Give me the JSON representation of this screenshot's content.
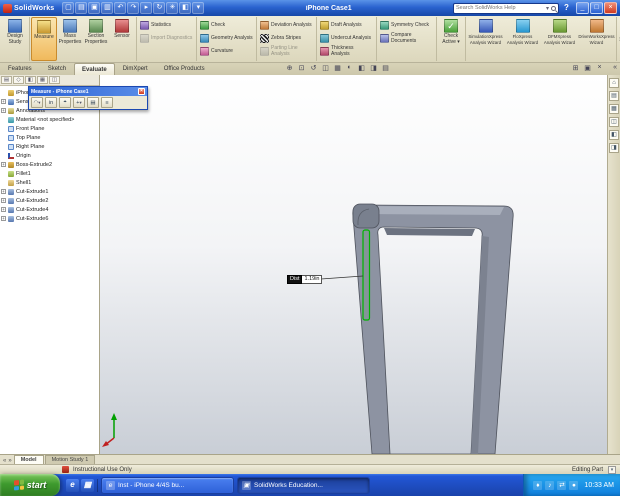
{
  "titlebar": {
    "app_name": "SolidWorks",
    "document_title": "iPhone Case1",
    "icons": [
      {
        "name": "new-icon",
        "glyph": "▢"
      },
      {
        "name": "open-icon",
        "glyph": "▤"
      },
      {
        "name": "save-icon",
        "glyph": "▣"
      },
      {
        "name": "print-icon",
        "glyph": "▥"
      },
      {
        "name": "undo-icon",
        "glyph": "↶"
      },
      {
        "name": "redo-icon",
        "glyph": "↷"
      },
      {
        "name": "select-icon",
        "glyph": "▸"
      },
      {
        "name": "rebuild-icon",
        "glyph": "↻"
      },
      {
        "name": "options-icon",
        "glyph": "✳"
      },
      {
        "name": "appearance-icon",
        "glyph": "◧"
      },
      {
        "name": "toolbar-more-icon",
        "glyph": "▾"
      }
    ],
    "search": {
      "placeholder": "Search SolidWorks Help",
      "arrow": "▾"
    },
    "help_glyph": "?",
    "window_buttons": [
      {
        "name": "minimize-button",
        "glyph": "_"
      },
      {
        "name": "maximize-button",
        "glyph": "□"
      },
      {
        "name": "close-button",
        "glyph": "×"
      }
    ]
  },
  "ribbon": {
    "overflow_glyph": "»",
    "groups": [
      {
        "type": "big",
        "items": [
          {
            "label": "Design Study",
            "icon": "design-study"
          }
        ]
      },
      {
        "type": "big",
        "items": [
          {
            "label": "Measure",
            "icon": "measure",
            "state": "active"
          },
          {
            "label": "Mass Properties",
            "icon": "mass-properties"
          },
          {
            "label": "Section Properties",
            "icon": "section-properties"
          },
          {
            "label": "Sensor",
            "icon": "sensor"
          }
        ]
      },
      {
        "type": "col",
        "items": [
          {
            "label": "Statistics",
            "icon": "statistics"
          },
          {
            "label": "Import Diagnostics",
            "icon": "import-diagnostics",
            "state": "disabled"
          }
        ]
      },
      {
        "type": "col",
        "items": [
          {
            "label": "Check",
            "icon": "check"
          },
          {
            "label": "Geometry Analysis",
            "icon": "geometry-analysis"
          },
          {
            "label": "Curvature",
            "icon": "curvature"
          }
        ]
      },
      {
        "type": "col",
        "items": [
          {
            "label": "Deviation Analysis",
            "icon": "deviation"
          },
          {
            "label": "Zebra Stripes",
            "icon": "zebra"
          },
          {
            "label": "Parting Line Analysis",
            "icon": "parting-line",
            "state": "disabled"
          }
        ]
      },
      {
        "type": "col",
        "items": [
          {
            "label": "Draft Analysis",
            "icon": "draft"
          },
          {
            "label": "Undercut Analysis",
            "icon": "undercut"
          },
          {
            "label": "Thickness Analysis",
            "icon": "thickness"
          }
        ]
      },
      {
        "type": "col",
        "items": [
          {
            "label": "Symmetry Check",
            "icon": "symmetry"
          },
          {
            "label": "Compare Documents",
            "icon": "compare"
          }
        ]
      },
      {
        "type": "big",
        "items": [
          {
            "label": "Check Active ▾",
            "icon": "check-active",
            "icon_glyph": "✓"
          }
        ]
      },
      {
        "type": "big",
        "size": "wide",
        "items": [
          {
            "label": "SimulationXpress Analysis Wizard",
            "icon": "simulationxpress"
          },
          {
            "label": "FloXpress Analysis Wizard",
            "icon": "floxpress"
          },
          {
            "label": "DFMXpress Analysis Wizard",
            "icon": "dfmxpress"
          },
          {
            "label": "DriveWorksXpress Wizard",
            "icon": "driveworksxpress"
          }
        ]
      }
    ]
  },
  "command_tabs": {
    "tabs": [
      {
        "label": "Features"
      },
      {
        "label": "Sketch"
      },
      {
        "label": "Evaluate",
        "state": "active"
      },
      {
        "label": "DimXpert"
      },
      {
        "label": "Office Products"
      }
    ],
    "collapse_glyph": "«"
  },
  "headsup": {
    "icons": [
      {
        "name": "zoom-fit-icon",
        "glyph": "⊕"
      },
      {
        "name": "zoom-area-icon",
        "glyph": "⊡"
      },
      {
        "name": "previous-view-icon",
        "glyph": "↺"
      },
      {
        "name": "section-view-icon",
        "glyph": "◫"
      },
      {
        "name": "view-orientation-icon",
        "glyph": "▦"
      },
      {
        "name": "display-style-icon",
        "glyph": "◐"
      },
      {
        "name": "hide-show-icon",
        "glyph": "◧"
      },
      {
        "name": "appearance-icon",
        "glyph": "◨"
      },
      {
        "name": "scene-icon",
        "glyph": "▤"
      }
    ],
    "right_icons": [
      {
        "name": "fullscreen-icon",
        "glyph": "⊞"
      },
      {
        "name": "panel-layout-icon",
        "glyph": "▣"
      },
      {
        "name": "close-toolbar-icon",
        "glyph": "×"
      }
    ]
  },
  "feature_tree": {
    "panel_tabs": [
      {
        "name": "feature-manager-tab",
        "glyph": "▤"
      },
      {
        "name": "property-manager-tab",
        "glyph": "◇"
      },
      {
        "name": "configuration-manager-tab",
        "glyph": "◧"
      },
      {
        "name": "dimxpert-manager-tab",
        "glyph": "▦"
      },
      {
        "name": "display-manager-tab",
        "glyph": "◫"
      }
    ],
    "root": {
      "label": "iPhone Case1",
      "icon": "part"
    },
    "items": [
      {
        "label": "Sensors",
        "icon": "sensors",
        "expand": "+"
      },
      {
        "label": "Annotations",
        "icon": "annotations",
        "expand": "+"
      },
      {
        "label": "Material <not specified>",
        "icon": "material"
      },
      {
        "label": "Front Plane",
        "icon": "plane"
      },
      {
        "label": "Top Plane",
        "icon": "plane"
      },
      {
        "label": "Right Plane",
        "icon": "plane"
      },
      {
        "label": "Origin",
        "icon": "origin"
      },
      {
        "label": "Boss-Extrude2",
        "icon": "boss",
        "expand": "+"
      },
      {
        "label": "Fillet1",
        "icon": "fillet"
      },
      {
        "label": "Shell1",
        "icon": "shell"
      },
      {
        "label": "Cut-Extrude1",
        "icon": "cut",
        "expand": "+"
      },
      {
        "label": "Cut-Extrude2",
        "icon": "cut",
        "expand": "+"
      },
      {
        "label": "Cut-Extrude4",
        "icon": "cut",
        "expand": "+"
      },
      {
        "label": "Cut-Extrude6",
        "icon": "cut",
        "expand": "+"
      }
    ]
  },
  "measure_dialog": {
    "title": "Measure - iPhone Case1",
    "close_glyph": "×",
    "buttons": [
      {
        "name": "arc-circle-measure-button",
        "glyph": "◠",
        "dropdown": "▾"
      },
      {
        "name": "units-button",
        "glyph": "in"
      },
      {
        "name": "show-xyz-button",
        "glyph": "⌖"
      },
      {
        "name": "point-to-point-button",
        "glyph": "+",
        "dropdown": "▾"
      },
      {
        "name": "measurement-history-button",
        "glyph": "▤"
      },
      {
        "name": "dialog-expand-button",
        "glyph": "≡"
      }
    ]
  },
  "viewport": {
    "measurement": {
      "label": "Dist",
      "value": "1.19in"
    }
  },
  "taskpane": {
    "icons": [
      {
        "name": "solidworks-resources-icon",
        "glyph": "⌂"
      },
      {
        "name": "design-library-icon",
        "glyph": "▤"
      },
      {
        "name": "file-explorer-icon",
        "glyph": "▦"
      },
      {
        "name": "search-pane-icon",
        "glyph": "◫"
      },
      {
        "name": "view-palette-icon",
        "glyph": "◧"
      },
      {
        "name": "custom-properties-icon",
        "glyph": "◨"
      }
    ]
  },
  "bottom_tabs": {
    "nav": [
      {
        "name": "tab-scroll-left-icon",
        "glyph": "«"
      },
      {
        "name": "tab-scroll-right-icon",
        "glyph": "»"
      }
    ],
    "tabs": [
      {
        "label": "Model",
        "state": "active"
      },
      {
        "label": "Motion Study 1"
      }
    ]
  },
  "statusbar": {
    "message": "Instructional Use Only",
    "mode": "Editing Part",
    "corner_glyph": "▾"
  },
  "taskbar": {
    "start_label": "start",
    "quick_launch": [
      {
        "name": "internet-explorer-quicklaunch-icon",
        "glyph": "e"
      },
      {
        "name": "show-desktop-icon",
        "glyph": "▦"
      }
    ],
    "tasks": [
      {
        "label": "Inst - iPhone 4/4S bu...",
        "icon_glyph": "e"
      },
      {
        "label": "SolidWorks Education...",
        "icon_glyph": "▣",
        "state": "active"
      }
    ],
    "tray_icons": [
      {
        "name": "security-tray-icon",
        "glyph": "♦"
      },
      {
        "name": "volume-tray-icon",
        "glyph": "♪"
      },
      {
        "name": "network-tray-icon",
        "glyph": "⇄"
      },
      {
        "name": "update-tray-icon",
        "glyph": "●"
      }
    ],
    "time": "10:33 AM"
  }
}
